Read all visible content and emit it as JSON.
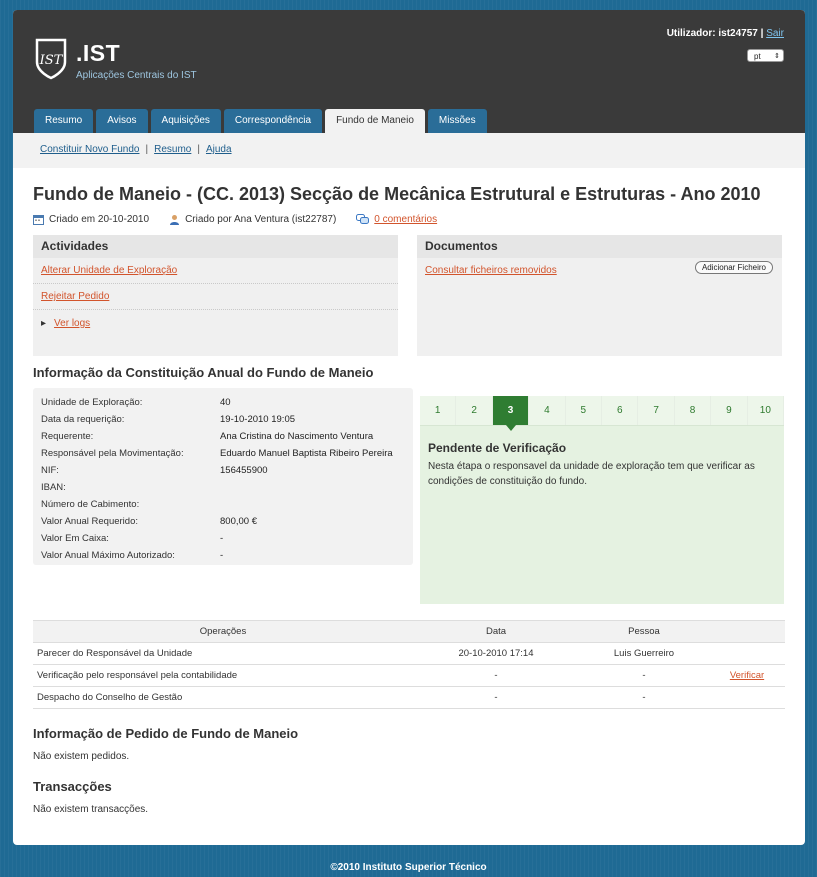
{
  "header": {
    "brand": ".IST",
    "brand_sub": "Aplicações Centrais do IST",
    "user_label": "Utilizador: ist24757 |",
    "logout": "Sair",
    "lang": "pt"
  },
  "tabs": [
    {
      "label": "Resumo"
    },
    {
      "label": "Avisos"
    },
    {
      "label": "Aquisições"
    },
    {
      "label": "Correspondência"
    },
    {
      "label": "Fundo de Maneio"
    },
    {
      "label": "Missões"
    }
  ],
  "subnav": [
    "Constituir Novo Fundo",
    "Resumo",
    "Ajuda"
  ],
  "page": {
    "title": "Fundo de Maneio - (CC. 2013) Secção de Mecânica Estrutural e Estruturas - Ano 2010",
    "created_on": "Criado em 20-10-2010",
    "created_by": "Criado por Ana Ventura (ist22787)",
    "comments": "0 comentários"
  },
  "activities": {
    "title": "Actividades",
    "links": [
      "Alterar Unidade de Exploração",
      "Rejeitar Pedido"
    ],
    "logs": "Ver logs"
  },
  "documents": {
    "title": "Documentos",
    "link": "Consultar ficheiros removidos",
    "button": "Adicionar Ficheiro"
  },
  "info": {
    "title": "Informação da Constituição Anual do Fundo de Maneio",
    "rows": [
      {
        "k": "Unidade de Exploração:",
        "v": "40"
      },
      {
        "k": "Data da requerição:",
        "v": "19-10-2010 19:05"
      },
      {
        "k": "Requerente:",
        "v": "Ana Cristina do Nascimento Ventura"
      },
      {
        "k": "Responsável pela Movimentação:",
        "v": "Eduardo Manuel Baptista Ribeiro Pereira"
      },
      {
        "k": "NIF:",
        "v": "156455900"
      },
      {
        "k": "IBAN:",
        "v": ""
      },
      {
        "k": "Número de Cabimento:",
        "v": ""
      },
      {
        "k": "Valor Anual Requerido:",
        "v": "800,00 €"
      },
      {
        "k": "Valor Em Caixa:",
        "v": "-"
      },
      {
        "k": "Valor Anual Máximo Autorizado:",
        "v": "-"
      }
    ]
  },
  "process": {
    "steps": [
      "1",
      "2",
      "3",
      "4",
      "5",
      "6",
      "7",
      "8",
      "9",
      "10"
    ],
    "current_step": 3,
    "status_title": "Pendente de Verificação",
    "status_text": "Nesta étapa o responsavel da unidade de exploração tem que verificar as condições de constituição do fundo."
  },
  "operations": {
    "headers": [
      "Operações",
      "Data",
      "Pessoa",
      ""
    ],
    "rows": [
      {
        "op": "Parecer do Responsável da Unidade",
        "date": "20-10-2010 17:14",
        "person": "Luis Guerreiro",
        "action": ""
      },
      {
        "op": "Verificação pelo responsável pela contabilidade",
        "date": "-",
        "person": "-",
        "action": "Verificar"
      },
      {
        "op": "Despacho do Conselho de Gestão",
        "date": "-",
        "person": "-",
        "action": ""
      }
    ]
  },
  "requests": {
    "title": "Informação de Pedido de Fundo de Maneio",
    "empty": "Não existem pedidos."
  },
  "transactions": {
    "title": "Transacções",
    "empty": "Não existem transacções."
  },
  "footer": "©2010 Instituto Superior Técnico",
  "colors": {
    "background": "#1f6a94",
    "header": "#3a3a3a",
    "tab": "#2a6d98",
    "link": "#d2542c",
    "step_active": "#2f7d32",
    "step_panel": "#e5f2e1"
  }
}
